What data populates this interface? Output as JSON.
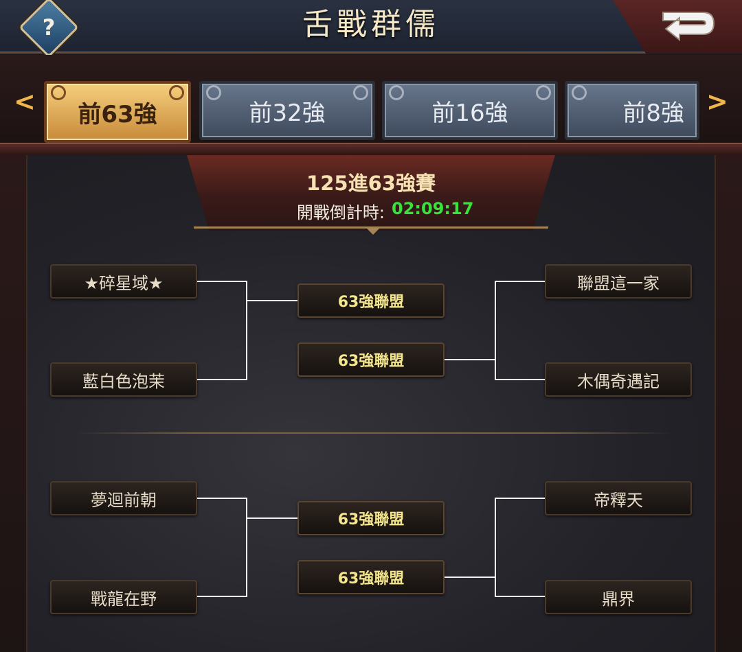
{
  "header": {
    "title": "舌戰群儒",
    "help_symbol": "?"
  },
  "tabs": [
    {
      "label": "前63強",
      "active": true
    },
    {
      "label": "前32強",
      "active": false
    },
    {
      "label": "前16強",
      "active": false
    },
    {
      "label": "前8強",
      "active": false
    }
  ],
  "nav": {
    "prev": "<",
    "next": ">"
  },
  "round": {
    "title": "125進63強賽",
    "countdown_label": "開戰倒計時:",
    "countdown_value": "02:09:17"
  },
  "brackets": [
    {
      "left_top": "★碎星域★",
      "left_bottom": "藍白色泡茉",
      "result_top": "63強聯盟",
      "result_bottom": "63強聯盟",
      "right_top": "聯盟這一家",
      "right_bottom": "木偶奇遇記"
    },
    {
      "left_top": "夢迴前朝",
      "left_bottom": "戰龍在野",
      "result_top": "63強聯盟",
      "result_bottom": "63強聯盟",
      "right_top": "帝釋天",
      "right_bottom": "鼎界"
    }
  ],
  "colors": {
    "countdown": "#37e23a",
    "winner_text": "#f3e68d",
    "active_tab": "#e9b45c",
    "tab_arrow": "#f0b84a"
  }
}
